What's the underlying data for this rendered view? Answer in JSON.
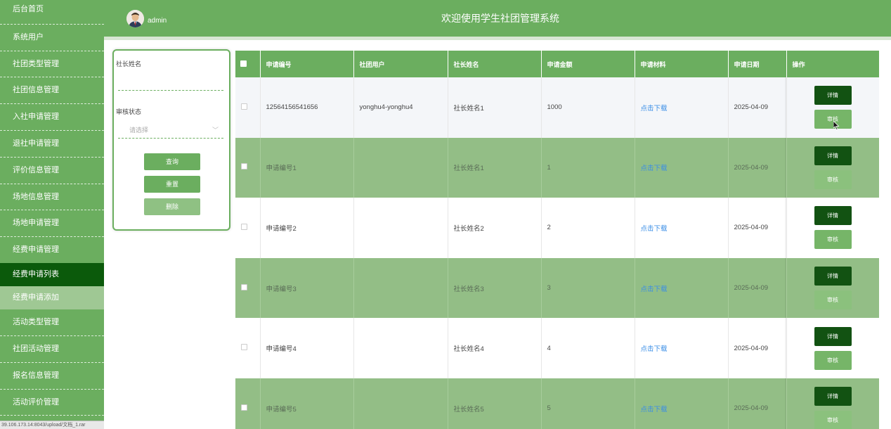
{
  "sidebar": {
    "items": [
      {
        "label": "后台首页"
      },
      {
        "label": "系统用户"
      },
      {
        "label": "社团类型管理"
      },
      {
        "label": "社团信息管理"
      },
      {
        "label": "入社申请管理"
      },
      {
        "label": "退社申请管理"
      },
      {
        "label": "评价信息管理"
      },
      {
        "label": "场地信息管理"
      },
      {
        "label": "场地申请管理"
      },
      {
        "label": "经费申请管理"
      },
      {
        "label": "经费申请列表"
      },
      {
        "label": "经费申请添加"
      },
      {
        "label": "活动类型管理"
      },
      {
        "label": "社团活动管理"
      },
      {
        "label": "报名信息管理"
      },
      {
        "label": "活动评价管理"
      }
    ],
    "status_url": "39.106.173.14:8043/upload/文档_1.rar"
  },
  "header": {
    "user": "admin",
    "title": "欢迎使用学生社团管理系统",
    "avatar_icon": "user-avatar-icon"
  },
  "search": {
    "president_label": "社长姓名",
    "status_label": "审核状态",
    "status_placeholder": "请选择",
    "query_label": "查询",
    "reset_label": "重置",
    "delete_label": "删除"
  },
  "table": {
    "headers": [
      "申请编号",
      "社团用户",
      "社长姓名",
      "申请金额",
      "申请材料",
      "申请日期",
      "操作"
    ],
    "rows": [
      {
        "code": "12564156541656",
        "user": "yonghu4-yonghu4",
        "president": "社长姓名1",
        "amount": "1000",
        "material": "点击下载",
        "date": "2025-04-09"
      },
      {
        "code": "申请编号1",
        "user": "",
        "president": "社长姓名1",
        "amount": "1",
        "material": "点击下载",
        "date": "2025-04-09"
      },
      {
        "code": "申请编号2",
        "user": "",
        "president": "社长姓名2",
        "amount": "2",
        "material": "点击下载",
        "date": "2025-04-09"
      },
      {
        "code": "申请编号3",
        "user": "",
        "president": "社长姓名3",
        "amount": "3",
        "material": "点击下载",
        "date": "2025-04-09"
      },
      {
        "code": "申请编号4",
        "user": "",
        "president": "社长姓名4",
        "amount": "4",
        "material": "点击下载",
        "date": "2025-04-09"
      },
      {
        "code": "申请编号5",
        "user": "",
        "president": "社长姓名5",
        "amount": "5",
        "material": "点击下载",
        "date": "2025-04-09"
      }
    ],
    "detail_label": "详情",
    "audit_label": "审核"
  },
  "colors": {
    "primary": "#6bae5f",
    "active_nav": "#0b5a0b",
    "dark_button": "#125212",
    "alt_row": "#93be86",
    "link": "#3a8ee6"
  }
}
